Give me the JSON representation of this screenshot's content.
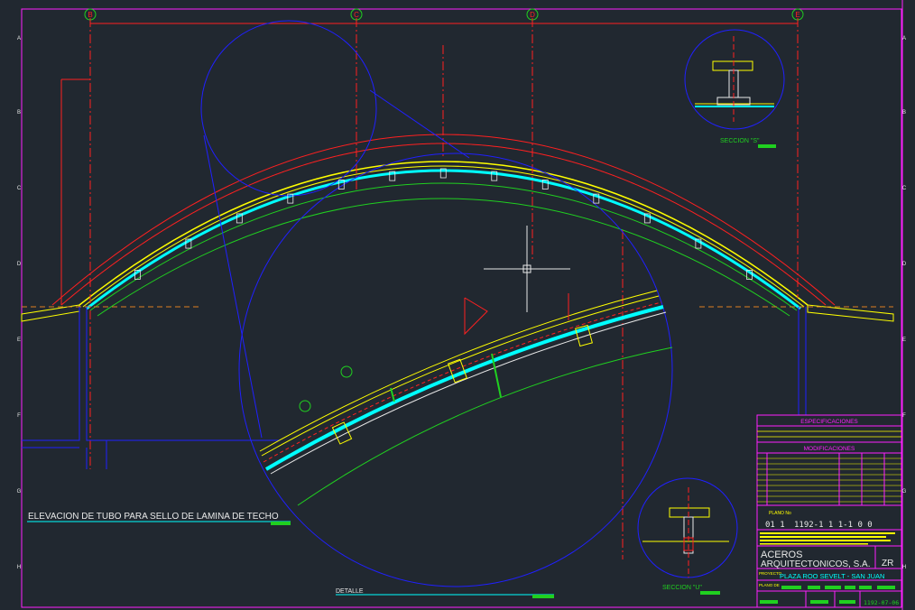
{
  "grid": {
    "columns": [
      "B",
      "C",
      "D",
      "E"
    ],
    "rows": [
      "A",
      "B",
      "C",
      "D",
      "E",
      "F",
      "G",
      "H"
    ]
  },
  "labels": {
    "main_title": "ELEVACION DE TUBO PARA SELLO DE LAMINA DE TECHO",
    "detail": "DETALLE",
    "section_s": "SECCION \"S\"",
    "section_u": "SECCION \"U\""
  },
  "title_block": {
    "especificaciones": "ESPECIFICACIONES",
    "modificaciones": "MODIFICACIONES",
    "plano_label": "PLANO No",
    "plano_number_prefix": "01 1",
    "plano_number": "1192-1 1 1-1 0 0",
    "company_line1": "ACEROS",
    "company_line2": "ARQUITECTONICOS, S.A.",
    "company_code": "ZR",
    "proyecto_label": "PROYECTO",
    "project": "PLAZA ROO SEVELT - SAN JUAN",
    "plano_de_label": "PLANO DE",
    "drawing_id": "1192-07-06"
  },
  "colors": {
    "background": "#212830",
    "red": "#ff2020",
    "blue": "#2020ff",
    "yellow": "#ffff00",
    "cyan": "#00ffff",
    "green": "#20d020",
    "magenta": "#ff20ff",
    "white": "#e8e8e8"
  },
  "icons": {
    "crosshair": "crosshair-cursor-icon"
  }
}
